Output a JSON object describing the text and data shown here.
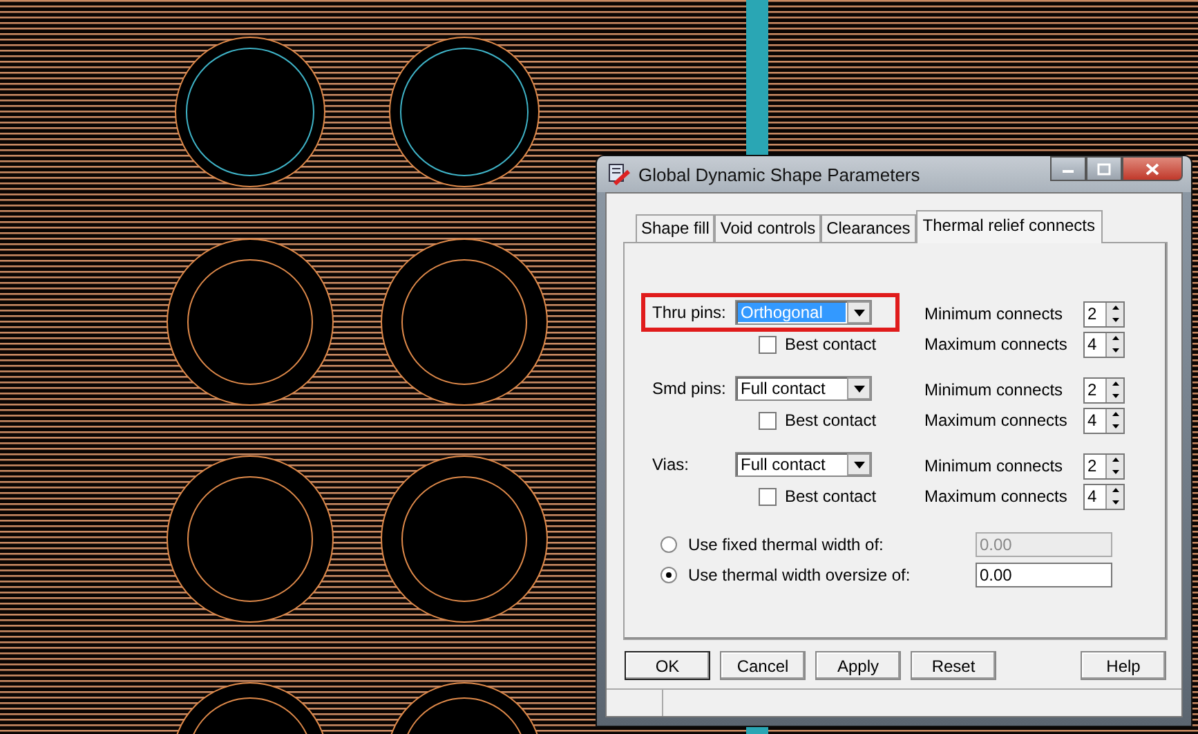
{
  "window": {
    "title": "Global Dynamic Shape Parameters"
  },
  "tabs": [
    {
      "label": "Shape fill",
      "selected": false
    },
    {
      "label": "Void controls",
      "selected": false
    },
    {
      "label": "Clearances",
      "selected": false
    },
    {
      "label": "Thermal relief connects",
      "selected": true
    }
  ],
  "pin_groups": [
    {
      "label": "Thru pins:",
      "value": "Orthogonal",
      "focused": true,
      "outlined": true,
      "best_contact": {
        "label": "Best contact",
        "checked": false
      },
      "min": {
        "label": "Minimum connects",
        "value": "2"
      },
      "max": {
        "label": "Maximum connects",
        "value": "4"
      }
    },
    {
      "label": "Smd pins:",
      "value": "Full contact",
      "focused": false,
      "outlined": false,
      "best_contact": {
        "label": "Best contact",
        "checked": false
      },
      "min": {
        "label": "Minimum connects",
        "value": "2"
      },
      "max": {
        "label": "Maximum connects",
        "value": "4"
      }
    },
    {
      "label": "Vias:",
      "value": "Full contact",
      "focused": false,
      "outlined": false,
      "best_contact": {
        "label": "Best contact",
        "checked": false
      },
      "min": {
        "label": "Minimum connects",
        "value": "2"
      },
      "max": {
        "label": "Maximum connects",
        "value": "4"
      }
    }
  ],
  "width_options": [
    {
      "label": "Use fixed thermal width of:",
      "selected": false,
      "value": "0.00",
      "disabled": true
    },
    {
      "label": "Use thermal width oversize of:",
      "selected": true,
      "value": "0.00",
      "disabled": false
    }
  ],
  "buttons": [
    {
      "label": "OK",
      "kind": "default"
    },
    {
      "label": "Cancel",
      "kind": "normal"
    },
    {
      "label": "Apply",
      "kind": "normal"
    },
    {
      "label": "Reset",
      "kind": "normal"
    },
    {
      "label": "Help",
      "kind": "help"
    }
  ]
}
